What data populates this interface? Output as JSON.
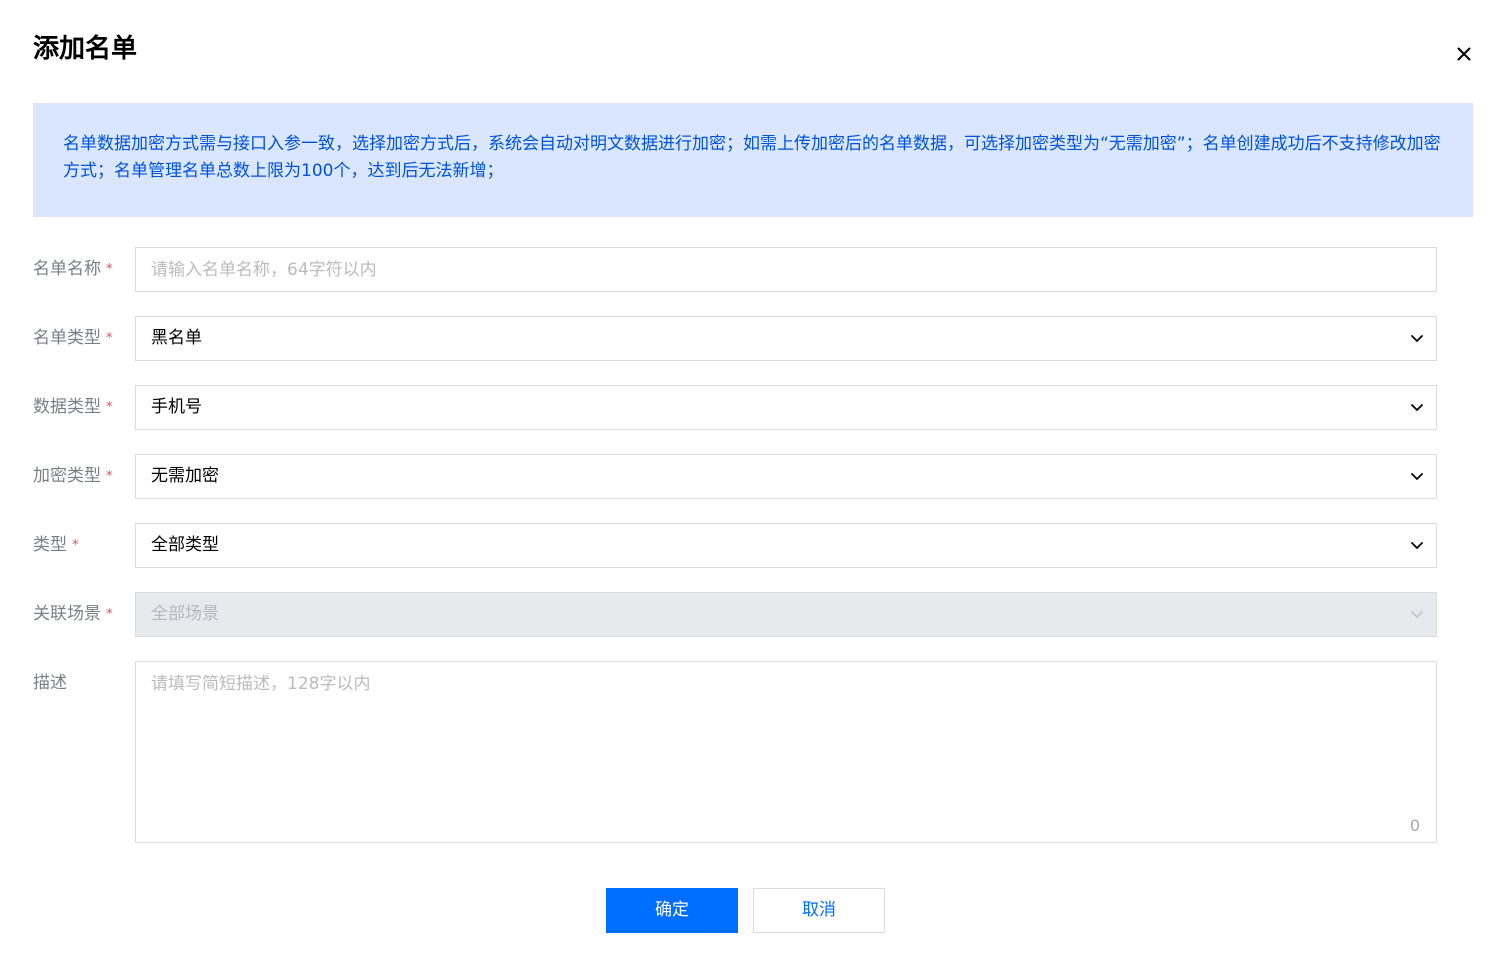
{
  "dialog": {
    "title": "添加名单"
  },
  "notice": {
    "text": "名单数据加密方式需与接口入参一致，选择加密方式后，系统会自动对明文数据进行加密；如需上传加密后的名单数据，可选择加密类型为“无需加密”；名单创建成功后不支持修改加密方式；名单管理名单总数上限为100个，达到后无法新增；"
  },
  "form": {
    "required_mark": "*",
    "name": {
      "label": "名单名称",
      "value": "",
      "placeholder": "请输入名单名称，64字符以内"
    },
    "list_type": {
      "label": "名单类型",
      "value": "黑名单"
    },
    "data_type": {
      "label": "数据类型",
      "value": "手机号"
    },
    "encrypt_type": {
      "label": "加密类型",
      "value": "无需加密"
    },
    "type": {
      "label": "类型",
      "value": "全部类型"
    },
    "scene": {
      "label": "关联场景",
      "value": "全部场景",
      "disabled": true
    },
    "description": {
      "label": "描述",
      "value": "",
      "placeholder": "请填写简短描述，128字以内",
      "count": "0"
    }
  },
  "buttons": {
    "confirm": "确定",
    "cancel": "取消"
  },
  "icons": {
    "close": "close-icon",
    "dropdown": "chevron-down-icon"
  },
  "colors": {
    "primary": "#006eff",
    "notice_bg": "#d9e6fe",
    "notice_text": "#0052d9",
    "required": "#e34d59",
    "disabled_bg": "#e7e9ec"
  }
}
